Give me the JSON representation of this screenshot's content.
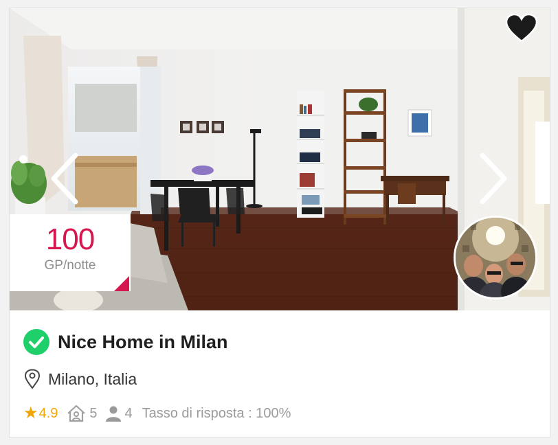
{
  "listing": {
    "title": "Nice Home in Milan",
    "location": "Milano, Italia",
    "price": {
      "value": "100",
      "unit": "GP/notte"
    },
    "rating": "4.9",
    "rooms": "5",
    "guests": "4",
    "response_rate": "Tasso di risposta : 100%",
    "verified": true,
    "favorite": true
  },
  "colors": {
    "accent": "#d6164f",
    "verified": "#1fcf6a",
    "star": "#f0a500",
    "muted": "#9a9a9a"
  },
  "icons": {
    "verified": "check-circle-icon",
    "location": "map-pin-icon",
    "rating": "star-icon",
    "rooms": "home-icon",
    "guests": "person-icon",
    "favorite": "heart-icon",
    "previous": "chevron-left-icon",
    "next": "chevron-right-icon"
  }
}
